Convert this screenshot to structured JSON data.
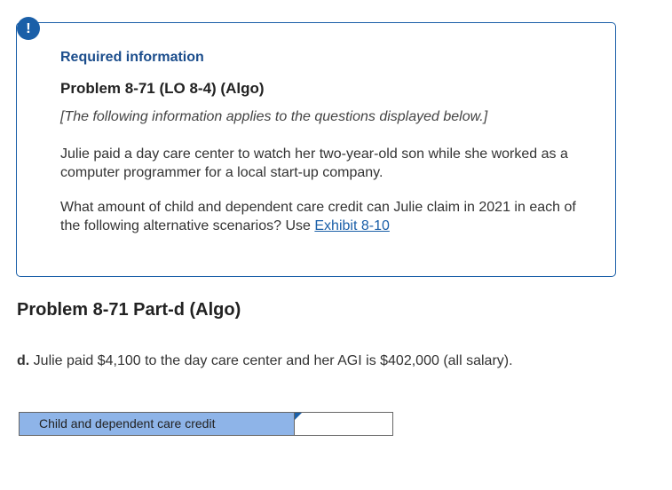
{
  "alert": {
    "icon": "exclamation-icon",
    "glyph": "!"
  },
  "info": {
    "heading": "Required information",
    "problem_title": "Problem 8-71 (LO 8-4) (Algo)",
    "intro": "[The following information applies to the questions displayed below.]",
    "paragraph1": "Julie paid a day care center to watch her two-year-old son while she worked as a computer programmer for a local start-up company.",
    "paragraph2_text": "What amount of child and dependent care credit can Julie claim in 2021 in each of the following alternative scenarios? Use ",
    "paragraph2_link": "Exhibit 8-10"
  },
  "part": {
    "title": "Problem 8-71 Part-d (Algo)",
    "question_label": "d.",
    "question_text": " Julie paid $4,100 to the day care center and her AGI is $402,000 (all salary)."
  },
  "answer": {
    "label": "Child and dependent care credit",
    "value": ""
  },
  "colors": {
    "accent": "#1a5fa8",
    "heading": "#1b4d8c",
    "label_bg": "#8eb4e8"
  }
}
